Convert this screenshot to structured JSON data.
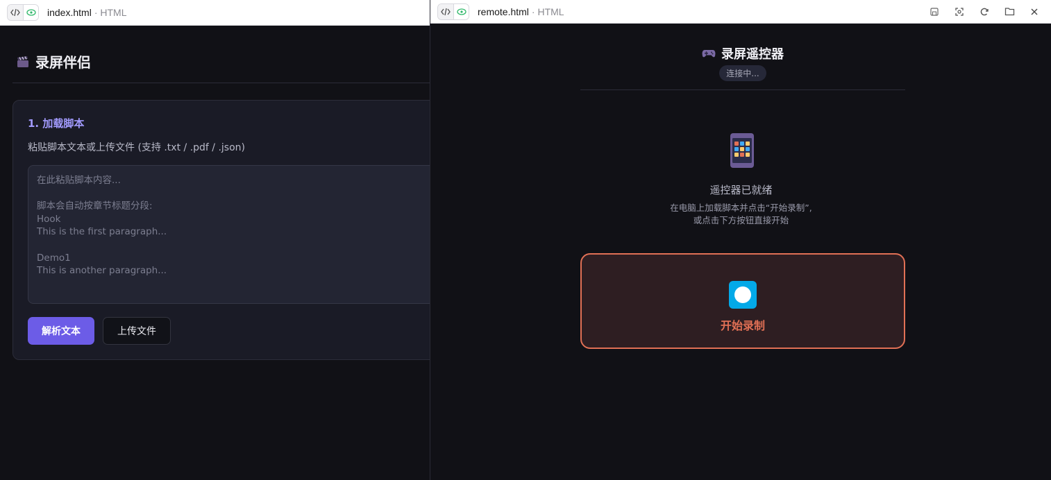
{
  "left_window": {
    "tab": {
      "name": "index.html",
      "type": "· HTML"
    },
    "app": {
      "title": "录屏伴侣",
      "icon": "clapperboard-icon",
      "section": {
        "title": "1. 加载脚本",
        "description": "粘贴脚本文本或上传文件 (支持 .txt / .pdf / .json)",
        "textarea_placeholder": "在此粘贴脚本内容...\n\n脚本会自动按章节标题分段:\nHook\nThis is the first paragraph...\n\nDemo1\nThis is another paragraph...",
        "parse_button": "解析文本",
        "upload_button": "上传文件"
      }
    }
  },
  "right_window": {
    "tab": {
      "name": "remote.html",
      "type": "· HTML"
    },
    "tab_actions": [
      "save-icon",
      "screenshot-icon",
      "refresh-icon",
      "folder-icon",
      "close-icon"
    ],
    "app": {
      "title": "录屏遥控器",
      "icon": "gamepad-icon",
      "status": "连接中...",
      "ready_title": "遥控器已就绪",
      "ready_desc_line1": "在电脑上加载脚本并点击“开始录制”,",
      "ready_desc_line2": "或点击下方按钮直接开始",
      "record_button": "开始录制"
    }
  },
  "colors": {
    "accent": "#6c5ce7",
    "accent_text": "#a29bfe",
    "record": "#e17055",
    "record_icon": "#03a9e8",
    "background": "#111116"
  }
}
